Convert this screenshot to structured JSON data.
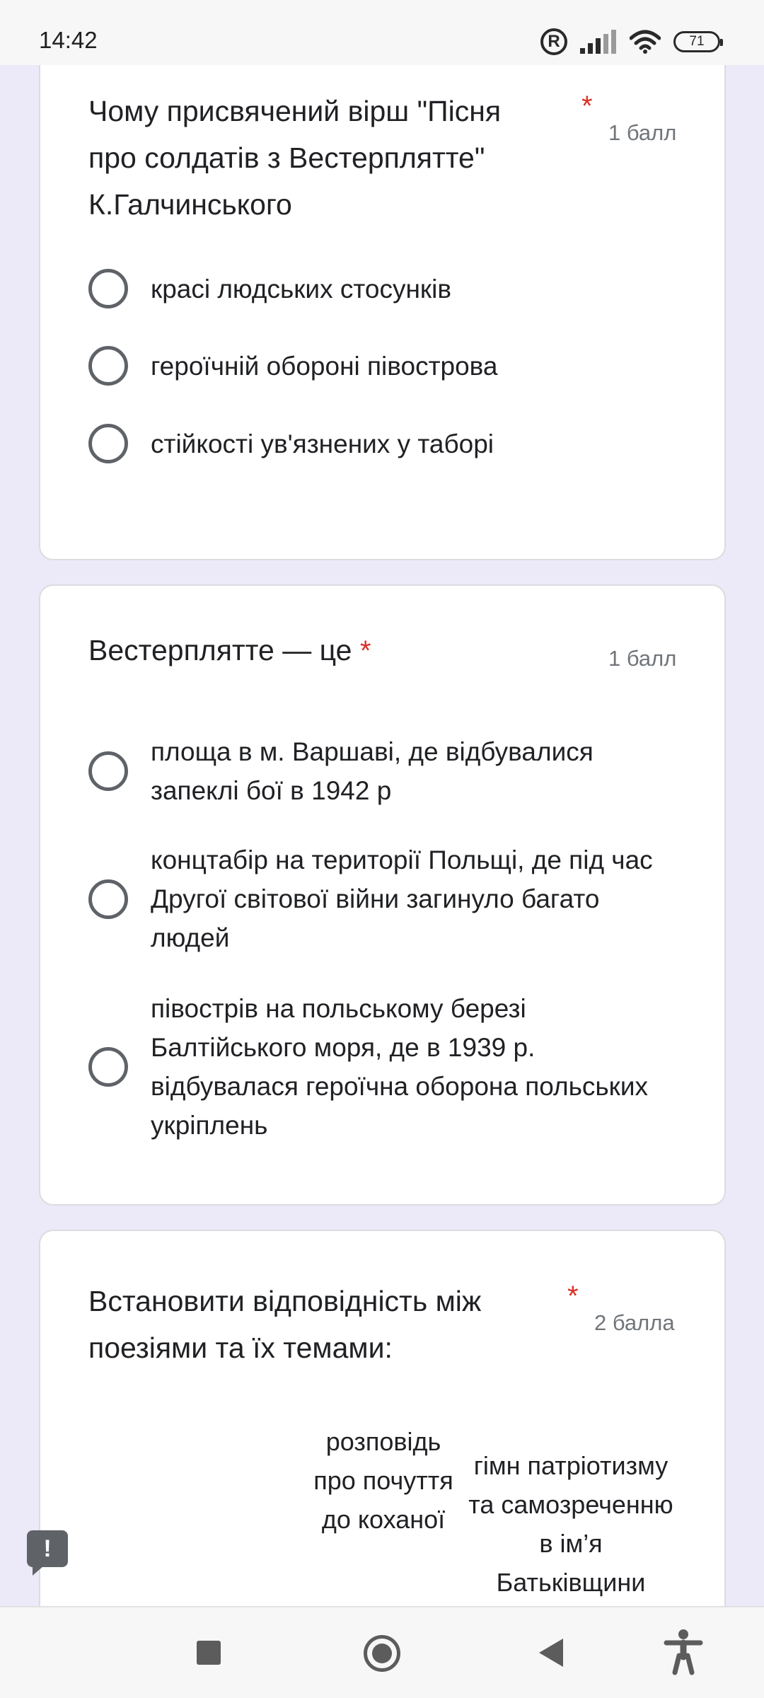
{
  "status_bar": {
    "time": "14:42",
    "battery": "71",
    "reg_mark": "R"
  },
  "questions": [
    {
      "title": "Чому присвячений вірш \"Пісня про солдатів з Вестерплятте\" К.Галчинського",
      "required_mark": "*",
      "points": "1 балл",
      "options": [
        "красі людських стосунків",
        "героїчній обороні півострова",
        "стійкості ув'язнених у таборі"
      ]
    },
    {
      "title": "Вестерплятте — це",
      "required_mark": "*",
      "points": "1 балл",
      "options": [
        "площа в м. Варшаві, де відбувалися запеклі бої в 1942 р",
        "концтабір на території Польщі, де під час Другої світової війни загинуло багато людей",
        "півострів на польському березі Балтійського моря, де в 1939 р. відбувалася героїчна оборона польських укріплень"
      ]
    },
    {
      "title": "Встановити відповідність між поезіями та їх темами:",
      "required_mark": "*",
      "points": "2 балла",
      "grid_columns": [
        "розповідь про почуття до коханої",
        "гімн патріотизму та самозреченню в ім’я Батьківщини"
      ]
    }
  ],
  "feedback_button": {
    "label": "!"
  },
  "nav_bar": {
    "icons": [
      "recents-icon",
      "home-icon",
      "back-icon",
      "accessibility-icon"
    ]
  },
  "colors": {
    "background": "#ece9f8",
    "required": "#d93025",
    "text": "#202124",
    "muted": "#70757a"
  }
}
